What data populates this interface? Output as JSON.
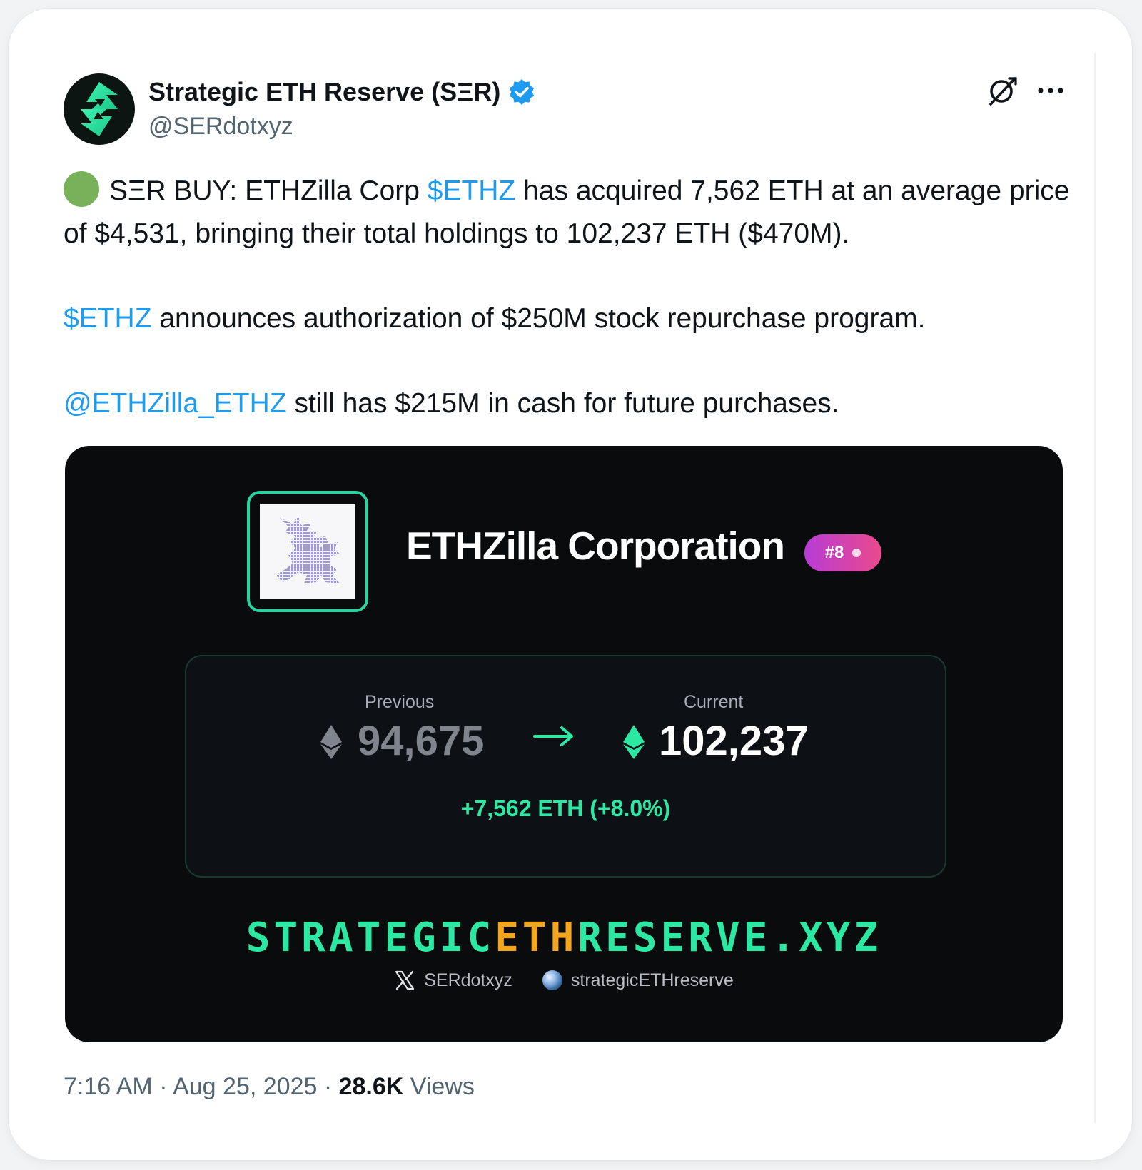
{
  "author": {
    "name": "Strategic ETH Reserve (SΞR)",
    "handle": "@SERdotxyz"
  },
  "tweet": {
    "line1_prefix": "SΞR BUY: ETHZilla Corp ",
    "ticker": "$ETHZ",
    "line1_suffix": " has acquired 7,562 ETH at an average price of $4,531, bringing their total holdings to 102,237 ETH ($470M).",
    "para2_suffix": " announces authorization of $250M stock repurchase program.",
    "mention": "@ETHZilla_ETHZ",
    "para3_suffix": " still has $215M in cash for future purchases."
  },
  "media": {
    "company": "ETHZilla Corporation",
    "rank": "#8",
    "previous_label": "Previous",
    "previous_value": "94,675",
    "current_label": "Current",
    "current_value": "102,237",
    "change": "+7,562 ETH (+8.0%)",
    "site_part1": "STRATEGIC",
    "site_part2": "ETH",
    "site_part3": "RESERVE.XYZ",
    "social_x": "SERdotxyz",
    "social_web": "strategicETHreserve"
  },
  "footer": {
    "time": "7:16 AM",
    "sep1": " · ",
    "date": "Aug 25, 2025",
    "sep2": " · ",
    "views_count": "28.6K",
    "views_label": " Views"
  },
  "colors": {
    "link": "#1d9bf0",
    "accent_green": "#2be8a3",
    "accent_orange": "#f2a51d",
    "badge_gradient_start": "#b83cd6",
    "badge_gradient_end": "#ea4a8c"
  },
  "icons": [
    "ser-logo-icon",
    "verified-badge-icon",
    "grok-icon",
    "more-options-icon",
    "green-circle-emoji-icon",
    "ethzilla-logo-icon",
    "eth-icon",
    "arrow-right-icon",
    "x-logo-icon",
    "globe-icon"
  ]
}
